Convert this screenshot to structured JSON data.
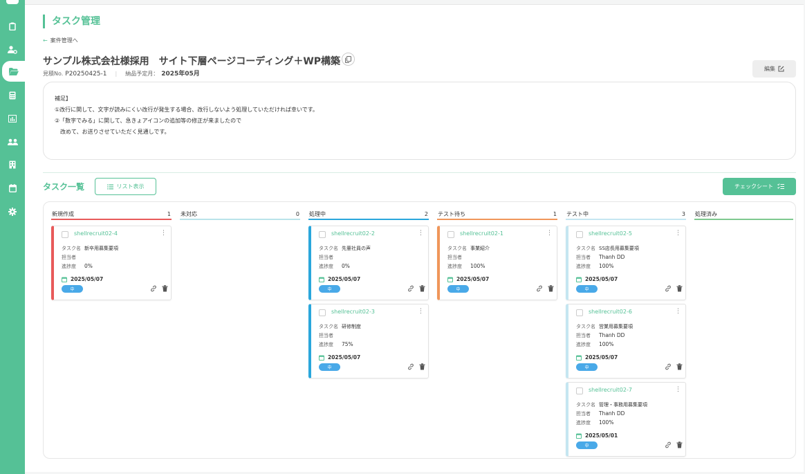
{
  "sidebar": {
    "items": [
      {
        "icon": "clipboard-icon"
      },
      {
        "icon": "user-gear-icon"
      },
      {
        "icon": "folder-open-icon",
        "active": true
      },
      {
        "icon": "calculator-icon"
      },
      {
        "icon": "bar-chart-icon"
      },
      {
        "icon": "users-icon"
      },
      {
        "icon": "building-icon"
      },
      {
        "icon": "calendar-icon"
      },
      {
        "icon": "gear-icon"
      }
    ]
  },
  "header": {
    "title": "タスク管理",
    "back_link": "案件管理へ"
  },
  "project": {
    "title": "サンプル株式会社様採用　サイト下層ページコーディング＋WP構築",
    "estimate_label": "見積No.",
    "estimate_no": "P20250425-1",
    "delivery_label": "納品予定月：",
    "delivery_month": "2025年05月",
    "edit_label": "編集"
  },
  "notes": {
    "lines": [
      "補足】",
      "①改行に関して、文字が読みにくい改行が発生する場合、改行しないよう処理していただければ幸いです。",
      "②「数字でみる」に関して、急きょアイコンの追加等の修正が来ましたので",
      "　改めて、お送りさせていただく見通しです。"
    ]
  },
  "tasks_section": {
    "title": "タスク一覧",
    "list_view_label": "リスト表示",
    "checksheet_label": "チェックシート"
  },
  "labels": {
    "task_name": "タスク名",
    "assignee": "担当者",
    "progress": "進捗度",
    "priority": "中"
  },
  "columns": [
    {
      "name": "新規作成",
      "count": "1",
      "color": "#e85a5a",
      "cards": [
        {
          "id": "shellrecruit02-4",
          "task": "新卒用募集要項",
          "assignee": "",
          "progress": "0%",
          "date": "2025/05/07",
          "priority": "中"
        }
      ]
    },
    {
      "name": "未対応",
      "count": "0",
      "color": "#b9e3ea",
      "cards": []
    },
    {
      "name": "処理中",
      "count": "2",
      "color": "#2aa7dc",
      "cards": [
        {
          "id": "shellrecruit02-2",
          "task": "先輩社員の声",
          "assignee": "",
          "progress": "0%",
          "date": "2025/05/07",
          "priority": "中"
        },
        {
          "id": "shellrecruit02-3",
          "task": "研修制度",
          "assignee": "",
          "progress": "75%",
          "date": "2025/05/07",
          "priority": "中"
        }
      ]
    },
    {
      "name": "テスト待ち",
      "count": "1",
      "color": "#f0965a",
      "cards": [
        {
          "id": "shellrecruit02-1",
          "task": "事業紹介",
          "assignee": "",
          "progress": "100%",
          "date": "2025/05/07",
          "priority": "中"
        }
      ]
    },
    {
      "name": "テスト中",
      "count": "3",
      "color": "#c5e6f1",
      "cards": [
        {
          "id": "shellrecruit02-5",
          "task": "SS店長用募集要項",
          "assignee": "Thanh DD",
          "progress": "100%",
          "date": "2025/05/07",
          "priority": "中"
        },
        {
          "id": "shellrecruit02-6",
          "task": "営業用募集要項",
          "assignee": "Thanh DD",
          "progress": "100%",
          "date": "2025/05/07",
          "priority": "中"
        },
        {
          "id": "shellrecruit02-7",
          "task": "管理・事務用募集要項",
          "assignee": "Thanh DD",
          "progress": "100%",
          "date": "2025/05/01",
          "priority": "中"
        }
      ]
    },
    {
      "name": "処理済み",
      "count": "",
      "color": "#7ec98f",
      "cards": []
    }
  ]
}
